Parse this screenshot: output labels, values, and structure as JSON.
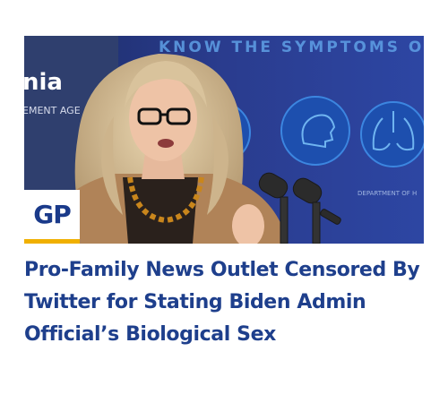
{
  "article": {
    "headline": "Pro-Family News Outlet Censored By Twitter for Stating Biden Admin Official’s Biological Sex"
  },
  "logo": {
    "text": "GP"
  },
  "photo": {
    "backdrop_banner": "KNOW THE SYMPTOMS OF COVID",
    "left_sign_word": "nia",
    "left_sign_sub": "EMENT AGE",
    "podium_caption": "DEPARTMENT OF H"
  },
  "colors": {
    "headline": "#1e3f8c",
    "logo_text": "#1a3a8a",
    "logo_accent": "#f0b000",
    "backdrop": "#25347a"
  }
}
